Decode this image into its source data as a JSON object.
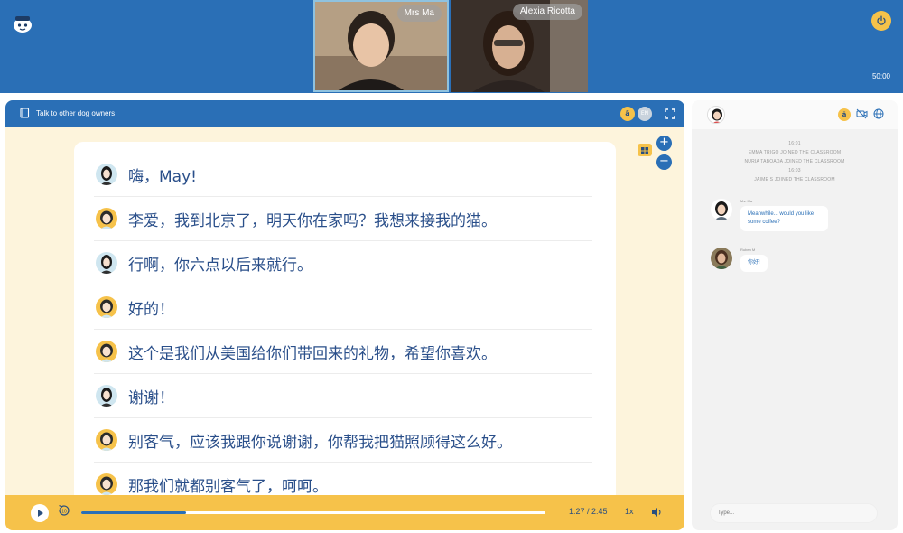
{
  "colors": {
    "primary": "#2a6fb6",
    "accent": "#f6c24a",
    "cream": "#fdf4dc",
    "text_blue": "#2a4f8a"
  },
  "video": {
    "participants": [
      {
        "name": "Mrs Ma"
      },
      {
        "name": "Alexia Ricotta"
      }
    ],
    "timer": "50:00"
  },
  "lesson": {
    "title": "Talk to other dog owners",
    "lang_toggle": {
      "active": "ä",
      "inactive": "EN"
    },
    "zoom_in": "+",
    "zoom_out": "−",
    "dialogue": [
      {
        "speaker": "a",
        "text": "嗨，May!"
      },
      {
        "speaker": "b",
        "text": "李爱，我到北京了，明天你在家吗？我想来接我的猫。"
      },
      {
        "speaker": "a",
        "text": "行啊，你六点以后来就行。"
      },
      {
        "speaker": "b",
        "text": "好的！"
      },
      {
        "speaker": "b",
        "text": "这个是我们从美国给你们带回来的礼物，希望你喜欢。"
      },
      {
        "speaker": "a",
        "text": "谢谢！"
      },
      {
        "speaker": "b",
        "text": "别客气，应该我跟你说谢谢，你帮我把猫照顾得这么好。"
      },
      {
        "speaker": "b",
        "text": "那我们就都别客气了，呵呵。"
      }
    ],
    "player": {
      "time": "1:27 / 2:45",
      "progress": 0.225,
      "speed": "1x"
    }
  },
  "chat": {
    "lang_badge": "ä",
    "system_messages": [
      "16:01",
      "EMMA TRIGO JOINED THE CLASSROOM",
      "NURIA TABOADA JOINED THE CLASSROOM",
      "16:03",
      "JAIME S JOINED THE CLASSROOM"
    ],
    "messages": [
      {
        "author": "Ms. Ma",
        "text_line1": "Meanwhile... would you like",
        "text_line2": "some coffee?"
      },
      {
        "author": "Ruben M",
        "text_line1": "你好!",
        "text_line2": ""
      }
    ],
    "input_placeholder": "Type..."
  }
}
